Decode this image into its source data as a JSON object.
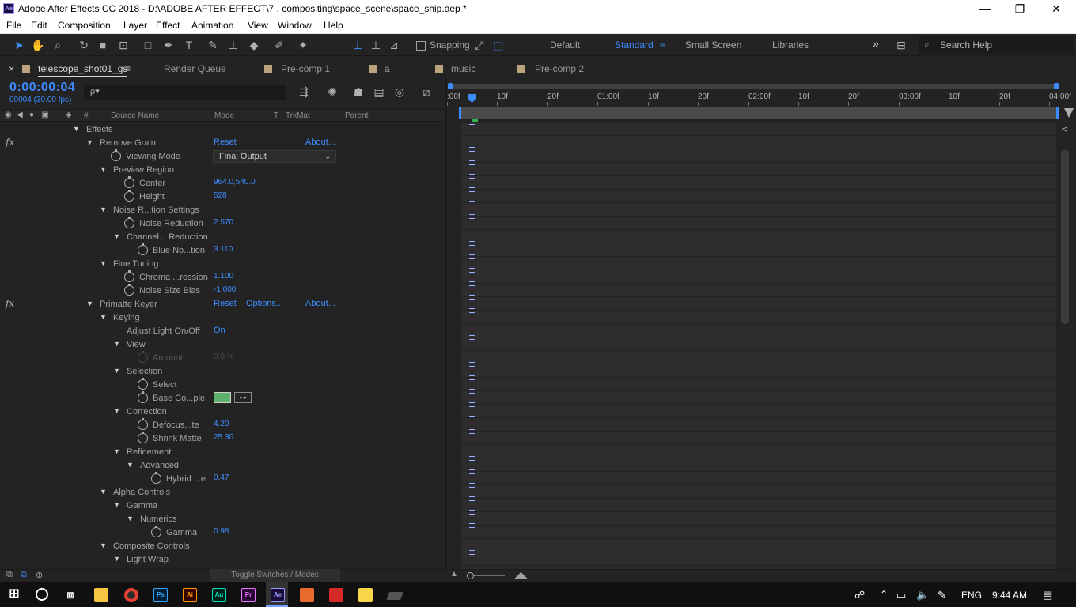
{
  "window": {
    "app_badge": "Ae",
    "title": "Adobe After Effects CC 2018 - D:\\ADOBE AFTER EFFECT\\7 . compositing\\space_scene\\space_ship.aep *",
    "minimize": "—",
    "restore": "❐",
    "close": "✕"
  },
  "menu": [
    "File",
    "Edit",
    "Composition",
    "Layer",
    "Effect",
    "Animation",
    "View",
    "Window",
    "Help"
  ],
  "toolbar": {
    "snapping_label": "Snapping",
    "workspaces": [
      "Default",
      "Standard",
      "Small Screen",
      "Libraries"
    ],
    "active_workspace": "Standard",
    "overflow": "»",
    "search_placeholder": "Search Help"
  },
  "tabs": {
    "close": "×",
    "active": "telescope_shot01_gs",
    "menu": "≡",
    "render_queue": "Render Queue",
    "others": [
      "Pre-comp 1",
      "a",
      "music",
      "Pre-comp 2"
    ]
  },
  "timeline_header": {
    "timecode": "0:00:00:04",
    "frame_info": "00004 (30.00 fps)",
    "search_icon_text": "ρ▾"
  },
  "columns": {
    "num": "#",
    "source_name": "Source Name",
    "mode": "Mode",
    "t": "T",
    "trkmat": "TrkMat",
    "parent": "Parent"
  },
  "effects": {
    "section_label": "Effects",
    "remove_grain": {
      "name": "Remove Grain",
      "reset": "Reset",
      "about": "About...",
      "viewing_mode_label": "Viewing Mode",
      "viewing_mode_value": "Final Output",
      "preview_region": "Preview Region",
      "center_label": "Center",
      "center_value": "964.0,540.0",
      "height_label": "Height",
      "height_value": "528",
      "noise_settings": "Noise R...tion Settings",
      "noise_reduction_label": "Noise Reduction",
      "noise_reduction_value": "2.570",
      "channel_reduction": "Channel... Reduction",
      "blue_noise_label": "Blue No...tion",
      "blue_noise_value": "3.110",
      "fine_tuning": "Fine Tuning",
      "chroma_label": "Chroma ...ression",
      "chroma_value": "1.100",
      "noise_size_label": "Noise Size Bias",
      "noise_size_value": "-1.000"
    },
    "primatte": {
      "name": "Primatte Keyer",
      "reset": "Reset",
      "options": "Options...",
      "about": "About...",
      "keying": "Keying",
      "adjust_light_label": "Adjust Light On/Off",
      "adjust_light_value": "On",
      "view": "View",
      "amount_label": "Amount",
      "amount_value": "0.0 %",
      "selection": "Selection",
      "select_label": "Select",
      "base_color_label": "Base Co...ple",
      "base_color": "#5fb06a",
      "correction": "Correction",
      "defocus_label": "Defocus...te",
      "defocus_value": "4.20",
      "shrink_label": "Shrink Matte",
      "shrink_value": "25.30",
      "refinement": "Refinement",
      "advanced": "Advanced",
      "hybrid_label": "Hybrid ...e",
      "hybrid_value": "0.47",
      "alpha_controls": "Alpha Controls",
      "gamma_group": "Gamma",
      "numerics": "Numerics",
      "gamma_label": "Gamma",
      "gamma_value": "0.98",
      "composite_controls": "Composite Controls",
      "light_wrap": "Light Wrap"
    }
  },
  "ruler": {
    "ticks": [
      ":00f",
      "10f",
      "20f",
      "01:00f",
      "10f",
      "20f",
      "02:00f",
      "10f",
      "20f",
      "03:00f",
      "10f",
      "20f",
      "04:00f"
    ]
  },
  "bottom": {
    "toggle_label": "Toggle Switches / Modes"
  },
  "taskbar": {
    "apps": [
      "Ps",
      "Ai",
      "Au",
      "Pr",
      "Ae"
    ],
    "language": "ENG",
    "time": "9:44 AM"
  },
  "colors": {
    "accent": "#3d8cff",
    "label_swatch": "#bba37d",
    "panel_bg": "#232323"
  }
}
